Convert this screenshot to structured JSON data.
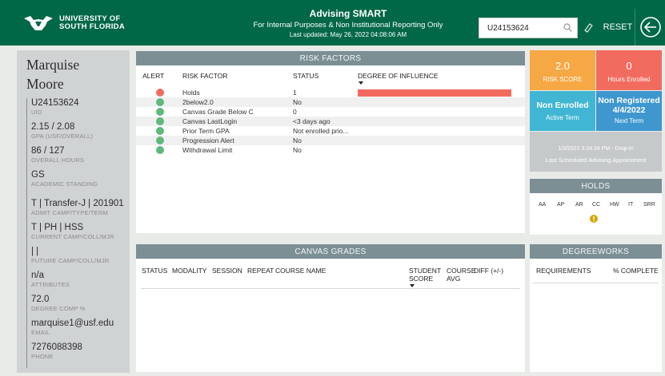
{
  "header": {
    "logo_line1": "UNIVERSITY OF",
    "logo_line2": "SOUTH FLORIDA",
    "title": "Advising SMART",
    "subtitle": "For Internal Purposes & Non Institutional Reporting Only",
    "updated": "Last updated: May 26, 2022 04:08:06 AM",
    "search_value": "U24153624",
    "reset_label": "RESET",
    "brand_color": "#006747"
  },
  "profile": {
    "first_name": "Marquise",
    "last_name": "Moore",
    "fields": [
      {
        "value": "U24153624",
        "label": "UID"
      },
      {
        "value": "2.15 / 2.08",
        "label": "GPA (USF/OVERALL)"
      },
      {
        "value": "86 / 127",
        "label": "OVERALL HOURS"
      },
      {
        "value": "GS",
        "label": "ACADEMIC STANDING"
      },
      {
        "value": "T | Transfer-J | 201901",
        "label": "ADMIT CAMP/TYPE/TERM"
      },
      {
        "value": "T | PH | HSS",
        "label": "CURRENT CAMP/COLL/MJR"
      },
      {
        "value": "| |",
        "label": "FUTURE CAMP/COLL/MJR"
      },
      {
        "value": "n/a",
        "label": "ATTRIBUTES"
      },
      {
        "value": "72.0",
        "label": "DEGREE COMP %"
      },
      {
        "value": "marquise1@usf.edu",
        "label": "EMAIL"
      },
      {
        "value": "7276088398",
        "label": "PHONE"
      }
    ]
  },
  "risk_factors": {
    "title": "RISK FACTORS",
    "columns": [
      "ALERT",
      "RISK FACTOR",
      "STATUS",
      "DEGREE OF INFLUENCE"
    ],
    "rows": [
      {
        "factor": "Holds",
        "status": "1",
        "alert": "red",
        "influence": 1.0
      },
      {
        "factor": "2below2.0",
        "status": "No",
        "alert": "green",
        "influence": 0
      },
      {
        "factor": "Canvas Grade Below C",
        "status": "0",
        "alert": "green",
        "influence": 0
      },
      {
        "factor": "Canvas LastLogin",
        "status": "<3 days ago",
        "alert": "green",
        "influence": 0
      },
      {
        "factor": "Prior Term GPA",
        "status": "Not enrolled prio...",
        "alert": "green",
        "influence": 0
      },
      {
        "factor": "Progression Alert",
        "status": "No",
        "alert": "green",
        "influence": 0
      },
      {
        "factor": "Withdrawal Limit",
        "status": "No",
        "alert": "green",
        "influence": 0
      }
    ],
    "colors": {
      "red": "#f26b5f",
      "green": "#5fb97a",
      "bar": "#f26b5f"
    }
  },
  "canvas_grades": {
    "title": "CANVAS GRADES",
    "columns": [
      "STATUS",
      "MODALITY",
      "SESSION",
      "REPEAT",
      "COURSE NAME",
      "STUDENT SCORE",
      "COURSE AVG",
      "DIFF (+/-)"
    ]
  },
  "tiles": {
    "risk_score": {
      "value": "2.0",
      "label": "RISK SCORE",
      "color": "#f5a843"
    },
    "hours_enrolled": {
      "value": "0",
      "label": "Hours Enrolled",
      "color": "#f26b5f"
    },
    "active_term": {
      "value": "Non Enrolled",
      "label": "Active Term",
      "color": "#41b6d4"
    },
    "next_term": {
      "value": "Non Registered 4/4/2022",
      "label": "Next Term",
      "color": "#3f97cf"
    },
    "appointment": {
      "value": "1/3/2022 3:24:34 PM - Drop-In",
      "label": "Last Scheduled Advising Appointment",
      "color": "#c5c9ca"
    }
  },
  "holds": {
    "title": "HOLDS",
    "codes": [
      "AA",
      "AP",
      "AR",
      "CC",
      "HW",
      "IT",
      "SRR"
    ],
    "flagged_code": "CC",
    "flag_color": "#d9a400"
  },
  "degreeworks": {
    "title": "DEGREEWORKS",
    "columns": [
      "REQUIREMENTS",
      "% COMPLETE"
    ]
  }
}
